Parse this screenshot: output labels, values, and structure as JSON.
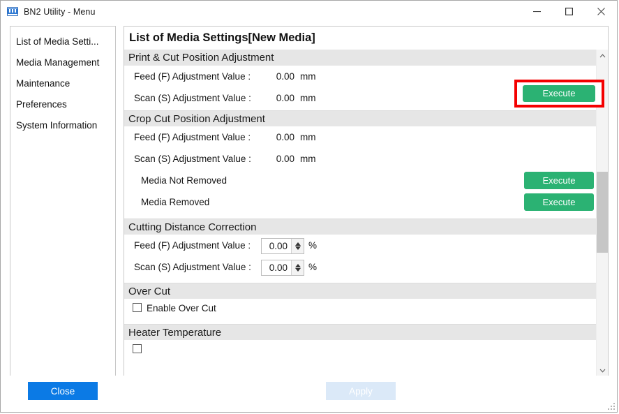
{
  "window": {
    "title": "BN2 Utility - Menu",
    "icon": "bn2-app-icon",
    "controls": {
      "minimize": "minimize-icon",
      "maximize": "maximize-icon",
      "close": "close-icon"
    }
  },
  "sidebar": {
    "items": [
      {
        "label": "List of Media Setti..."
      },
      {
        "label": "Media Management"
      },
      {
        "label": "Maintenance"
      },
      {
        "label": "Preferences"
      },
      {
        "label": "System Information"
      }
    ]
  },
  "main": {
    "title": "List of Media Settings[New Media]",
    "sections": [
      {
        "header": "Print & Cut Position Adjustment",
        "rows": [
          {
            "label": "Feed (F) Adjustment Value :",
            "value": "0.00",
            "unit": "mm"
          },
          {
            "label": "Scan (S) Adjustment Value :",
            "value": "0.00",
            "unit": "mm"
          }
        ],
        "execute_label": "Execute"
      },
      {
        "header": "Crop Cut Position Adjustment",
        "rows": [
          {
            "label": "Feed (F) Adjustment Value :",
            "value": "0.00",
            "unit": "mm"
          },
          {
            "label": "Scan (S) Adjustment Value :",
            "value": "0.00",
            "unit": "mm"
          },
          {
            "label": "Media Not Removed",
            "execute_label": "Execute"
          },
          {
            "label": "Media Removed",
            "execute_label": "Execute"
          }
        ]
      },
      {
        "header": "Cutting Distance Correction",
        "rows": [
          {
            "label": "Feed (F) Adjustment Value :",
            "value": "0.00",
            "unit": "%"
          },
          {
            "label": "Scan (S) Adjustment Value :",
            "value": "0.00",
            "unit": "%"
          }
        ]
      },
      {
        "header": "Over Cut",
        "checkbox_label": "Enable Over Cut",
        "checkbox_checked": false
      },
      {
        "header": "Heater Temperature"
      }
    ]
  },
  "scrollbar": {
    "up_icon": "chevron-up-icon",
    "down_icon": "chevron-down-icon"
  },
  "footer": {
    "close_label": "Close",
    "apply_label": "Apply",
    "apply_enabled": false
  },
  "annotation": {
    "highlight_color": "#f40000",
    "target": "print-cut-execute-button"
  },
  "colors": {
    "execute_green": "#2bb273",
    "close_blue": "#0b7ae5",
    "apply_disabled": "#dbe9f8",
    "section_header_bg": "#e6e6e6"
  }
}
